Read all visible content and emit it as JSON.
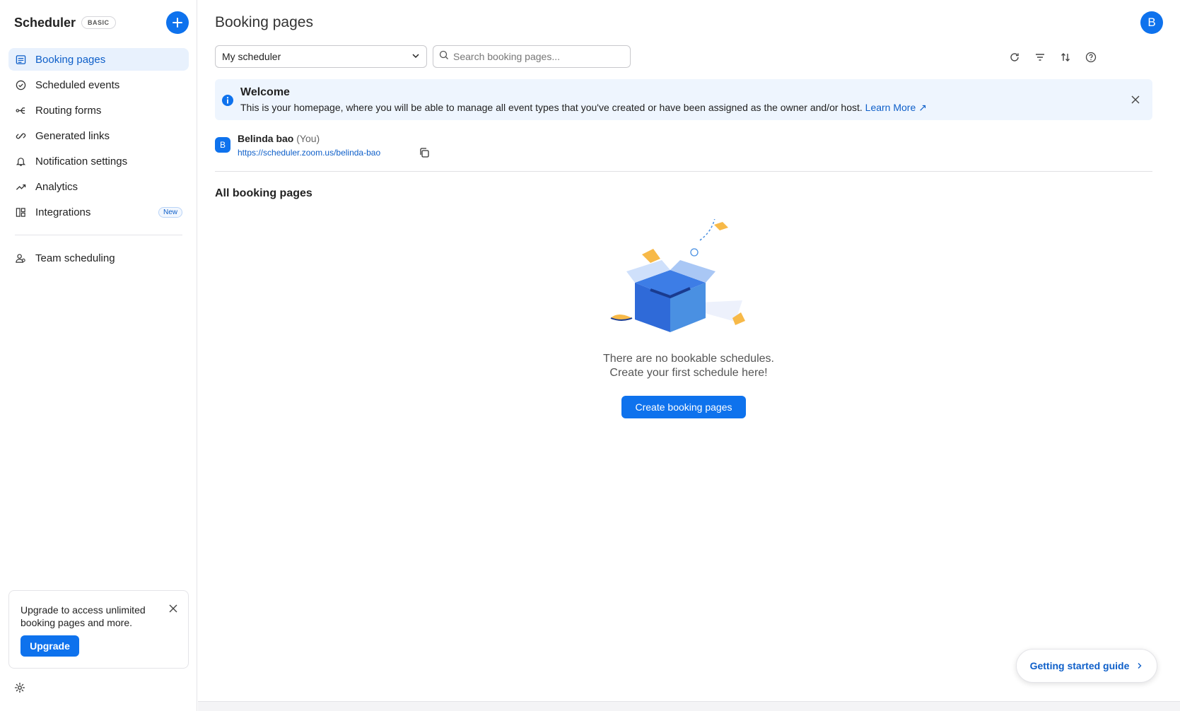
{
  "app": {
    "title": "Scheduler",
    "plan_badge": "BASIC",
    "accent_color": "#0e72ed",
    "link_color": "#0e5fc9"
  },
  "sidebar": {
    "items": [
      {
        "label": "Booking pages",
        "icon": "booking-pages-icon",
        "active": true
      },
      {
        "label": "Scheduled events",
        "icon": "check-circle-icon"
      },
      {
        "label": "Routing forms",
        "icon": "routing-icon"
      },
      {
        "label": "Generated links",
        "icon": "link-icon"
      },
      {
        "label": "Notification settings",
        "icon": "bell-icon"
      },
      {
        "label": "Analytics",
        "icon": "trend-icon"
      },
      {
        "label": "Integrations",
        "icon": "integrations-icon",
        "badge": "New"
      }
    ],
    "secondary_items": [
      {
        "label": "Team scheduling",
        "icon": "team-icon"
      }
    ],
    "upgrade": {
      "text": "Upgrade to access unlimited booking pages and more.",
      "button": "Upgrade"
    }
  },
  "header": {
    "title": "Booking pages",
    "avatar_initial": "B"
  },
  "toolbar": {
    "scheduler_select": "My scheduler",
    "search_placeholder": "Search booking pages...",
    "tools": [
      "refresh-icon",
      "filter-icon",
      "sort-icon",
      "help-icon"
    ]
  },
  "banner": {
    "title": "Welcome",
    "text": "This is your homepage, where you will be able to manage all event types that you've created or have been assigned as the owner and/or host.",
    "link": "Learn More ↗"
  },
  "owner": {
    "initial": "B",
    "name": "Belinda bao",
    "you_tag": "(You)",
    "url": "https://scheduler.zoom.us/belinda-bao"
  },
  "main": {
    "section_title": "All booking pages",
    "empty_line1": "There are no bookable schedules.",
    "empty_line2": "Create your first schedule here!",
    "create_button": "Create booking pages"
  },
  "guide": {
    "label": "Getting started guide"
  }
}
